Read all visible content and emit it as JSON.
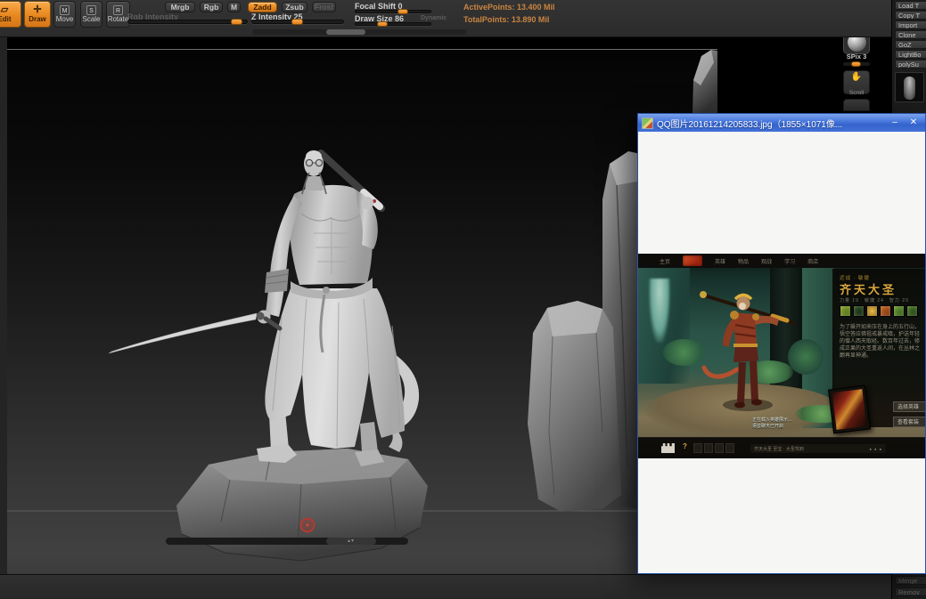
{
  "colors": {
    "accent_orange": "#ef9b30",
    "titlebar_blue": "#3f6fd1",
    "hero_gold": "#d9a83f"
  },
  "icons": {
    "edit": "▱",
    "draw": "✛",
    "hand": "✋",
    "scroll_arrows": "▴▾",
    "move_key": "M",
    "scale_key": "S",
    "rotate_key": "R"
  },
  "zbrush": {
    "toolbar": {
      "edit": "Edit",
      "draw": "Draw",
      "move": "Move",
      "scale": "Scale",
      "rotate": "Rotate",
      "mrgb": "Mrgb",
      "rgb": "Rgb",
      "m": "M",
      "rgb_intensity": "Rgb Intensity",
      "zadd": "Zadd",
      "zsub": "Zsub",
      "frost": "Frost",
      "z_intensity": "Z Intensity 25",
      "focal_shift": "Focal Shift 0",
      "draw_size": "Draw Size 86",
      "dynamic": "Dynamic",
      "active_points": "ActivePoints: 13.400 Mil",
      "total_points": "TotalPoints: 13.890 Mil"
    },
    "right_shelf": {
      "spix": "SPix 3",
      "scroll": "Scroll"
    },
    "tool_panel": {
      "items": [
        "Load T",
        "Copy T",
        "Import",
        "Clone",
        "GoZ",
        "LightBo",
        "polySu"
      ],
      "merge": "Merge",
      "remove": "Remov"
    }
  },
  "viewer": {
    "title": "QQ图片20161214205833.jpg（1855×1071像...",
    "minimize": "–",
    "close": "✕"
  },
  "dota": {
    "menu_home": "主页",
    "menu": [
      "英雄",
      "物品",
      "观战",
      "学习",
      "商店"
    ],
    "hero_tag": "近战 · 敏捷",
    "hero_name": "齐天大圣",
    "hero_stats": "力量 19　敏捷 24　智力 20",
    "hero_desc": "为了躲开如来压在身上的五行山，悟空答应佛祖戒暴戒嗔，护送年轻的僧人西天取经。数百年过去，修成正果的大圣重返人间，在丛林之巅再显神通。",
    "btn_select": "选择英雄",
    "btn_sets": "查看套装",
    "help": "?",
    "chat_line1": "正在载入英雄展示…",
    "chat_line2": "语音聊天已开启",
    "status_text": "齐天大圣 至宝 · 大圣驾到",
    "status_dots": "● ● ●"
  }
}
